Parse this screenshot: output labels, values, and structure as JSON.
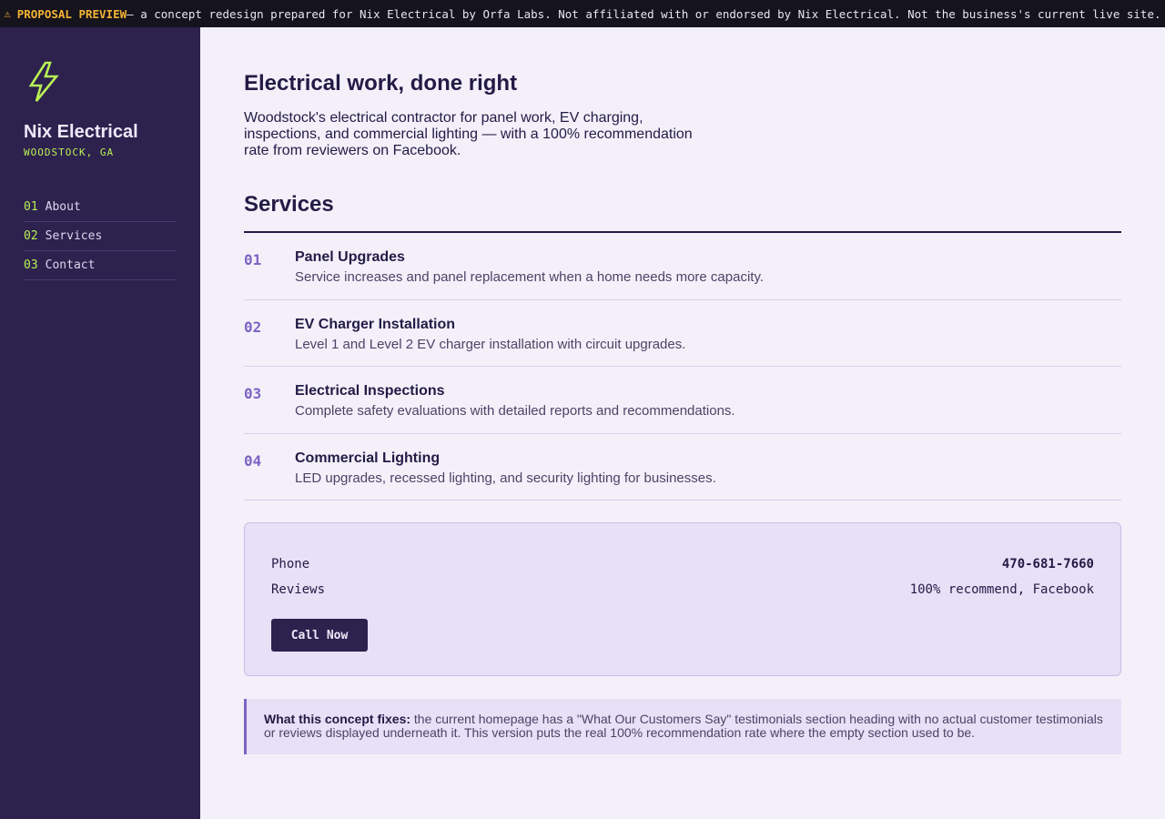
{
  "banner": {
    "icon": "construction-icon",
    "label": "PROPOSAL PREVIEW",
    "text": " — a concept redesign prepared for Nix Electrical by Orfa Labs. Not affiliated with or endorsed by Nix Electrical. Not the business's current live site."
  },
  "sidebar": {
    "logo_icon": "lightning-bolt-icon",
    "brand_name": "Nix Electrical",
    "location": "WOODSTOCK, GA",
    "nav": [
      {
        "num": "01",
        "label": "About"
      },
      {
        "num": "02",
        "label": "Services"
      },
      {
        "num": "03",
        "label": "Contact"
      }
    ]
  },
  "hero": {
    "title": "Electrical work, done right",
    "description": "Woodstock's electrical contractor for panel work, EV charging, inspections, and commercial lighting — with a 100% recommendation rate from reviewers on Facebook."
  },
  "services": {
    "title": "Services",
    "items": [
      {
        "num": "01",
        "name": "Panel Upgrades",
        "desc": "Service increases and panel replacement when a home needs more capacity."
      },
      {
        "num": "02",
        "name": "EV Charger Installation",
        "desc": "Level 1 and Level 2 EV charger installation with circuit upgrades."
      },
      {
        "num": "03",
        "name": "Electrical Inspections",
        "desc": "Complete safety evaluations with detailed reports and recommendations."
      },
      {
        "num": "04",
        "name": "Commercial Lighting",
        "desc": "LED upgrades, recessed lighting, and security lighting for businesses."
      }
    ]
  },
  "contact": {
    "phone_label": "Phone",
    "phone_value": "470-681-7660",
    "reviews_label": "Reviews",
    "reviews_value": "100% recommend, Facebook",
    "call_button": "Call Now"
  },
  "note": {
    "lead": "What this concept fixes:",
    "text": " the current homepage has a \"What Our Customers Say\" testimonials section heading with no actual customer testimonials or reviews displayed underneath it. This version puts the real 100% recommendation rate where the empty section used to be."
  },
  "colors": {
    "sidebar_bg": "#2d214e",
    "accent_green": "#b8ef55",
    "accent_purple": "#7e64c4",
    "banner_accent": "#f5b335",
    "page_bg": "#f3f0fa"
  }
}
